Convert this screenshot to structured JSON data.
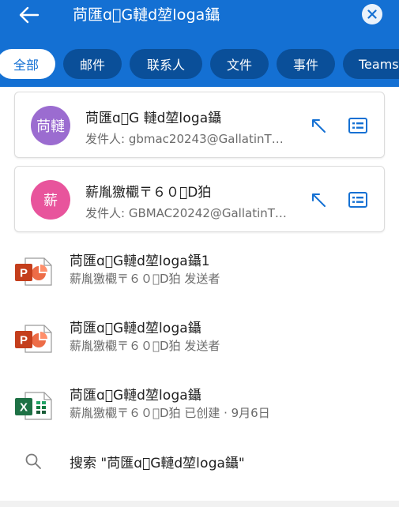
{
  "search": {
    "query": "苘匯ɑ\u0000G轋d堃l໐ga鑷",
    "back_icon": "arrow-left-icon",
    "clear_icon": "close-circle-icon"
  },
  "filters": [
    {
      "label": "全部",
      "active": true
    },
    {
      "label": "邮件",
      "active": false
    },
    {
      "label": "联系人",
      "active": false
    },
    {
      "label": "文件",
      "active": false
    },
    {
      "label": "事件",
      "active": false
    },
    {
      "label": "Teams",
      "active": false
    }
  ],
  "contacts": [
    {
      "initials": "苘轋",
      "avatar_color": "#9b6cd0",
      "name": "苘匯ɑ\u0000G 轋d堃l໐ga鑷",
      "sender": "发件人: gbmac20243@GallatinT…",
      "icons": [
        "reply-arrow-icon",
        "contact-card-icon"
      ]
    },
    {
      "initials": "薪",
      "avatar_color": "#e8549c",
      "name": "薪胤獥欟〒６０\u0000D狛",
      "sender": "发件人: GBMAC20242@GallatinT…",
      "icons": [
        "reply-arrow-icon",
        "contact-card-icon"
      ]
    }
  ],
  "files": [
    {
      "type": "powerpoint",
      "letter": "P",
      "name": "苘匯ɑ\u0000G轋d堃l໐ga鑷1",
      "detail": "薪胤獥欟〒６０\u0000D狛 发送者"
    },
    {
      "type": "powerpoint",
      "letter": "P",
      "name": "苘匯ɑ\u0000G轋d堃l໐ga鑷",
      "detail": "薪胤獥欟〒６０\u0000D狛 发送者"
    },
    {
      "type": "excel",
      "letter": "X",
      "name": "苘匯ɑ\u0000G轋d堃l໐ga鑷",
      "detail": "薪胤獥欟〒６０\u0000D狛 已创建 · 9月6日"
    }
  ],
  "suggestion": {
    "icon": "search-icon",
    "text": "搜索 \"苘匯ɑ\u0000G轋d堃l໐ga鑷\""
  },
  "colors": {
    "header": "#1470d3",
    "chip": "#0a4f99",
    "accent": "#1470d3",
    "powerpoint": "#c43e1c",
    "excel": "#1e7145"
  }
}
